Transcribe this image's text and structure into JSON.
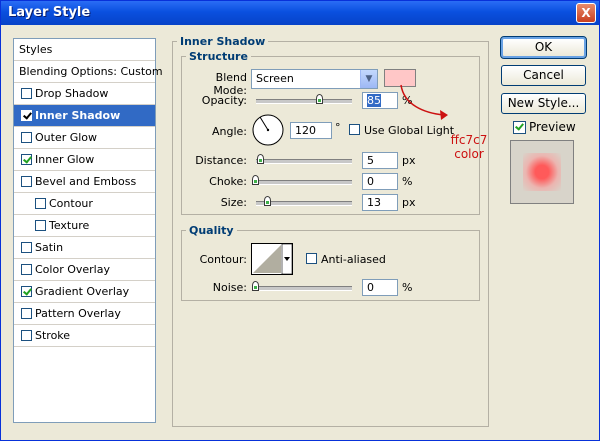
{
  "window": {
    "title": "Layer Style",
    "close_label": "X"
  },
  "sidebar": {
    "header": "Styles",
    "items": [
      {
        "label": "Blending Options: Custom"
      },
      {
        "label": "Drop Shadow",
        "checked": false
      },
      {
        "label": "Inner Shadow",
        "checked": true,
        "selected": true
      },
      {
        "label": "Outer Glow",
        "checked": false
      },
      {
        "label": "Inner Glow",
        "checked": true
      },
      {
        "label": "Bevel and Emboss",
        "checked": false
      },
      {
        "label": "Contour",
        "checked": false
      },
      {
        "label": "Texture",
        "checked": false
      },
      {
        "label": "Satin",
        "checked": false
      },
      {
        "label": "Color Overlay",
        "checked": false
      },
      {
        "label": "Gradient Overlay",
        "checked": true
      },
      {
        "label": "Pattern Overlay",
        "checked": false
      },
      {
        "label": "Stroke",
        "checked": false
      }
    ]
  },
  "inner_shadow": {
    "title": "Inner Shadow",
    "structure": {
      "title": "Structure",
      "blend_mode_label": "Blend Mode:",
      "blend_mode_value": "Screen",
      "blend_color": "#ffc7c7",
      "opacity_label": "Opacity:",
      "opacity_value": "85",
      "opacity_unit": "%",
      "angle_label": "Angle:",
      "angle_value": "120",
      "angle_unit": "°",
      "global_light_label": "Use Global Light",
      "global_light_checked": false,
      "distance_label": "Distance:",
      "distance_value": "5",
      "distance_unit": "px",
      "choke_label": "Choke:",
      "choke_value": "0",
      "choke_unit": "%",
      "size_label": "Size:",
      "size_value": "13",
      "size_unit": "px"
    },
    "quality": {
      "title": "Quality",
      "contour_label": "Contour:",
      "anti_aliased_label": "Anti-aliased",
      "anti_aliased_checked": false,
      "noise_label": "Noise:",
      "noise_value": "0",
      "noise_unit": "%"
    }
  },
  "annotation": {
    "line1": "ffc7c7",
    "line2": "color",
    "color": "#cc1111"
  },
  "buttons": {
    "ok": "OK",
    "cancel": "Cancel",
    "new_style": "New Style...",
    "preview": "Preview",
    "preview_checked": true
  },
  "preview_color": "#ff5a5a"
}
